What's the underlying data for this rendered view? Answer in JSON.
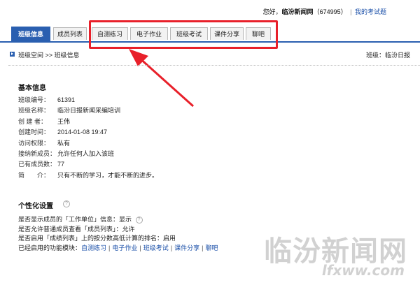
{
  "header": {
    "greeting": "您好，",
    "user_name": "临汾新闻网",
    "user_id": "（674995）",
    "separator": "|",
    "my_exam_link": "我的考试题"
  },
  "tabs": [
    {
      "label": "班级信息",
      "active": true
    },
    {
      "label": "成员列表",
      "active": false
    },
    {
      "label": "自测练习",
      "active": false
    },
    {
      "label": "电子作业",
      "active": false
    },
    {
      "label": "班级考试",
      "active": false
    },
    {
      "label": "课件分享",
      "active": false
    },
    {
      "label": "聊吧",
      "active": false
    }
  ],
  "breadcrumb": {
    "text": "班级空间 >> 班级信息",
    "right_text": "班级：临汾日报"
  },
  "basic_info": {
    "title": "基本信息",
    "rows": [
      {
        "label": "班级编号：",
        "value": "61391"
      },
      {
        "label": "班级名称：",
        "value": "临汾日报新闻采编培训"
      },
      {
        "label": "创 建 者：",
        "value": "王伟"
      },
      {
        "label": "创建时间：",
        "value": "2014-01-08 19:47"
      },
      {
        "label": "访问权限：",
        "value": "私有"
      },
      {
        "label": "接纳新成员：",
        "value": "允许任何人加入该班"
      },
      {
        "label": "已有成员数：",
        "value": "77"
      },
      {
        "label": "简　　介：",
        "value": "只有不断的学习，才能不断的进步。"
      }
    ]
  },
  "personalize": {
    "title": "个性化设置",
    "help_glyph": "?",
    "row1_text": "是否显示成员的「工作单位」信息：显示",
    "row2_text": "是否允许普通成员查看「成员列表」：允许",
    "row3_text": "是否启用「成绩列表」上的按分数高低计算的排名：启用",
    "modules_label": "已经启用的功能模块：",
    "modules": [
      "自测练习",
      "电子作业",
      "班级考试",
      "课件分享",
      "聊吧"
    ],
    "module_sep": "|"
  },
  "watermark": {
    "title": "临汾新闻网",
    "url": "lfxww.com"
  },
  "colors": {
    "tab_active": "#2a5fb0",
    "highlight": "#e8202a",
    "link": "#1a4fa8"
  }
}
